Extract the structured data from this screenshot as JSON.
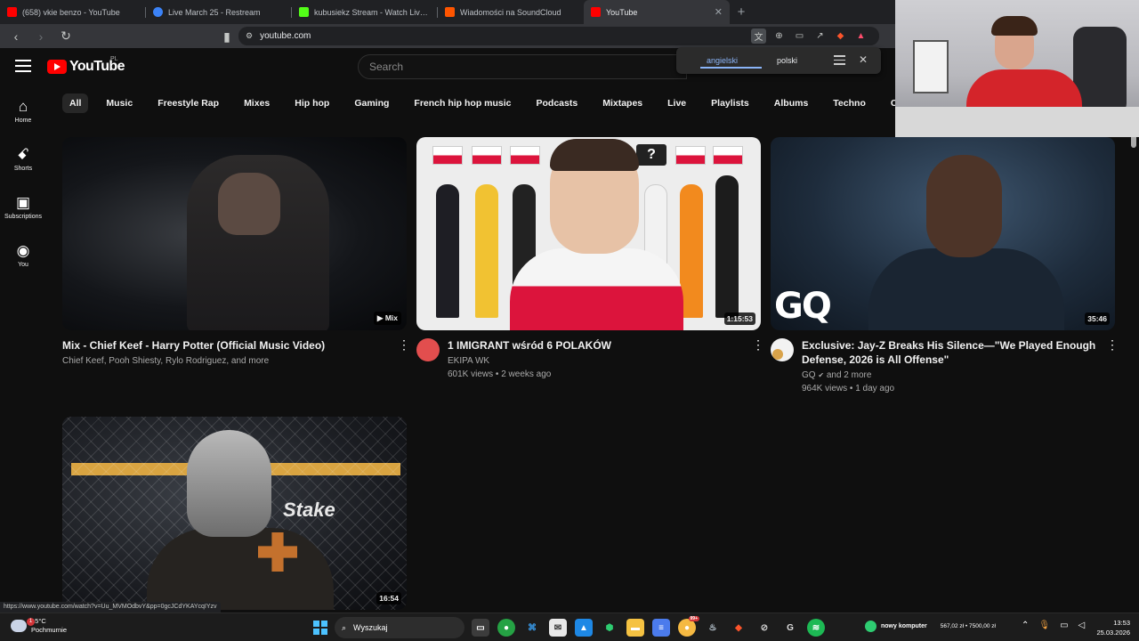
{
  "browser": {
    "tabs": [
      {
        "title": "(658) vkie benzo - YouTube",
        "favicon_color": "#ff0000",
        "active": false
      },
      {
        "title": "Live March 25 - Restream",
        "favicon_color": "#3b82f6",
        "active": false
      },
      {
        "title": "kubusiekz Stream - Watch Live on Ki",
        "favicon_color": "#53fc18",
        "active": false
      },
      {
        "title": "Wiadomości na SoundCloud",
        "favicon_color": "#ff5500",
        "active": false
      },
      {
        "title": "YouTube",
        "favicon_color": "#ff0000",
        "active": true
      }
    ],
    "new_tab_label": "+",
    "address": "youtube.com",
    "status_url": "https://www.youtube.com/watch?v=Uu_MVMOdbvY&pp=0gcJCdYKAYcqIYzv"
  },
  "translate_popup": {
    "source_lang": "angielski",
    "target_lang": "polski"
  },
  "youtube": {
    "logo_text": "YouTube",
    "country_code": "PL",
    "search_placeholder": "Search",
    "guide": [
      {
        "label": "Home",
        "icon": "home-icon",
        "glyph": "⌂"
      },
      {
        "label": "Shorts",
        "icon": "shorts-icon",
        "glyph": "ꗃ"
      },
      {
        "label": "Subscriptions",
        "icon": "subscriptions-icon",
        "glyph": "▣"
      },
      {
        "label": "You",
        "icon": "you-icon",
        "glyph": "◉"
      }
    ],
    "chips": [
      "All",
      "Music",
      "Freestyle Rap",
      "Mixes",
      "Hip hop",
      "Gaming",
      "French hip hop music",
      "Podcasts",
      "Mixtapes",
      "Live",
      "Playlists",
      "Albums",
      "Techno",
      "Counter-Strike:"
    ],
    "videos": [
      {
        "title": "Mix - Chief Keef - Harry Potter (Official Music Video)",
        "channel": "Chief Keef, Pooh Shiesty, Rylo Rodriguez, and more",
        "stats": "",
        "badge": "Mix",
        "avatar_color": ""
      },
      {
        "title": "1 IMIGRANT wśród 6 POLAKÓW",
        "channel": "EKIPA WK",
        "stats": "601K views • 2 weeks ago",
        "badge": "1:15:53",
        "avatar_color": "#e24e4e"
      },
      {
        "title": "Exclusive: Jay-Z Breaks His Silence—\"We Played Enough Defense, 2026 is All Offense\"",
        "channel": "GQ",
        "channel_extra": "and 2 more",
        "stats": "964K views • 1 day ago",
        "badge": "35:46",
        "avatar_color": "#f2f2f2"
      },
      {
        "title": "",
        "channel": "",
        "stats": "",
        "badge": "16:54",
        "avatar_color": ""
      }
    ],
    "thumb_text": {
      "gq_logo": "GQ",
      "stake_logo": "Stake",
      "question": "?"
    }
  },
  "taskbar": {
    "weather_temp": "15°C",
    "weather_desc": "Pochmurnie",
    "weather_badge": "1",
    "search_label": "Wyszukaj",
    "widget_label": "nowy komputer",
    "widget_value": "567,02 zł • 7500,00 zł",
    "time": "13:53",
    "date": "25.03.2026",
    "app_badge": "99+"
  }
}
